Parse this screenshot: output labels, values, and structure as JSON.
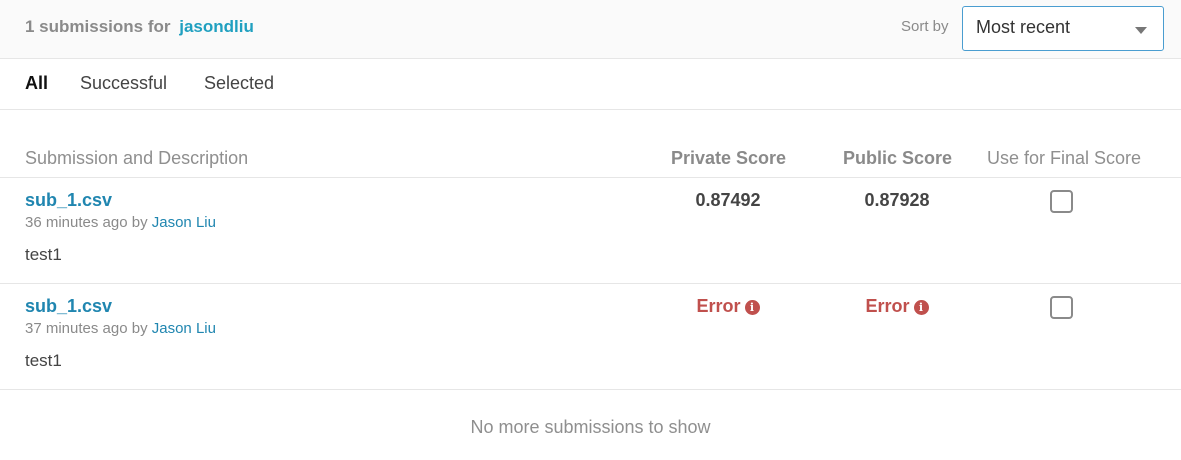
{
  "header": {
    "title_prefix": "1 submissions for",
    "username": "jasondliu",
    "sort_label": "Sort by",
    "sort_value": "Most recent"
  },
  "tabs": [
    "All",
    "Successful",
    "Selected"
  ],
  "table": {
    "headers": {
      "submission": "Submission and Description",
      "private": "Private Score",
      "public": "Public Score",
      "final": "Use for Final Score"
    },
    "rows": [
      {
        "filename": "sub_1.csv",
        "time": "36 minutes ago by",
        "user": "Jason Liu",
        "description": "test1",
        "private_score": "0.87492",
        "public_score": "0.87928",
        "selected": false
      },
      {
        "filename": "sub_1.csv",
        "time": "37 minutes ago by",
        "user": "Jason Liu",
        "description": "test1",
        "private_score": "Error",
        "public_score": "Error",
        "selected": false
      }
    ]
  },
  "footer": "No more submissions to show",
  "info_glyph": "i"
}
